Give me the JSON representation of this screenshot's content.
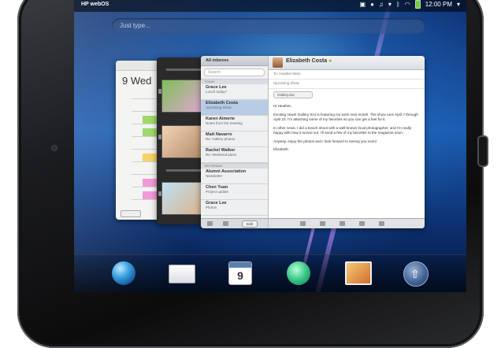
{
  "status": {
    "title": "HP webOS",
    "time": "12:00 PM",
    "icons": [
      "notifications-icon",
      "chat-icon",
      "music-icon",
      "bluetooth-icon",
      "wifi-icon",
      "battery-icon",
      "menu-chevron-icon"
    ]
  },
  "search": {
    "placeholder": "Just type..."
  },
  "calendar_card": {
    "date": "9 Wed"
  },
  "email_card": {
    "list_title": "All inboxes",
    "search_placeholder": "Search",
    "section_today": "TODAY",
    "section_yesterday": "YESTERDAY",
    "messages": [
      {
        "name": "Grace Lee",
        "subject": "Lunch today?",
        "selected": false
      },
      {
        "name": "Elizabeth Costa",
        "subject": "Upcoming Show",
        "selected": true
      },
      {
        "name": "Karen Aimerie",
        "subject": "Notes from the meeting",
        "selected": false
      },
      {
        "name": "Matt Navarro",
        "subject": "Re: Gallery photos",
        "selected": false
      },
      {
        "name": "Rachel Walker",
        "subject": "Re: Weekend plans",
        "selected": false
      },
      {
        "name": "Alumni Association",
        "subject": "Newsletter",
        "selected": false
      },
      {
        "name": "Chen Yuan",
        "subject": "Project update",
        "selected": false
      },
      {
        "name": "Grace Lee",
        "subject": "Photos",
        "selected": false
      }
    ],
    "edit_label": "Edit",
    "from": "Elizabeth Costa",
    "to_line": "To: Heather Mars",
    "subject_line": "Upcoming Show",
    "attachment": "Gallery.doc",
    "body": [
      "Hi Heather,",
      "Exciting news! Gallery 814 is featuring my work next month. The show runs April 7 through April 23. I'm attaching some of my favorites so you can get a feel for it.",
      "In other news, I did a beach shoot with a well-known local photographer, and I'm really happy with how it turned out. I'll send a few of my favorites to the magazine soon.",
      "Anyway, enjoy the photos and I look forward to seeing you soon!",
      "Elizabeth"
    ]
  },
  "dock": {
    "calendar_day": "9",
    "apps": [
      "web-browser-icon",
      "email-icon",
      "calendar-icon",
      "messaging-icon",
      "photos-icon",
      "launcher-icon"
    ]
  }
}
